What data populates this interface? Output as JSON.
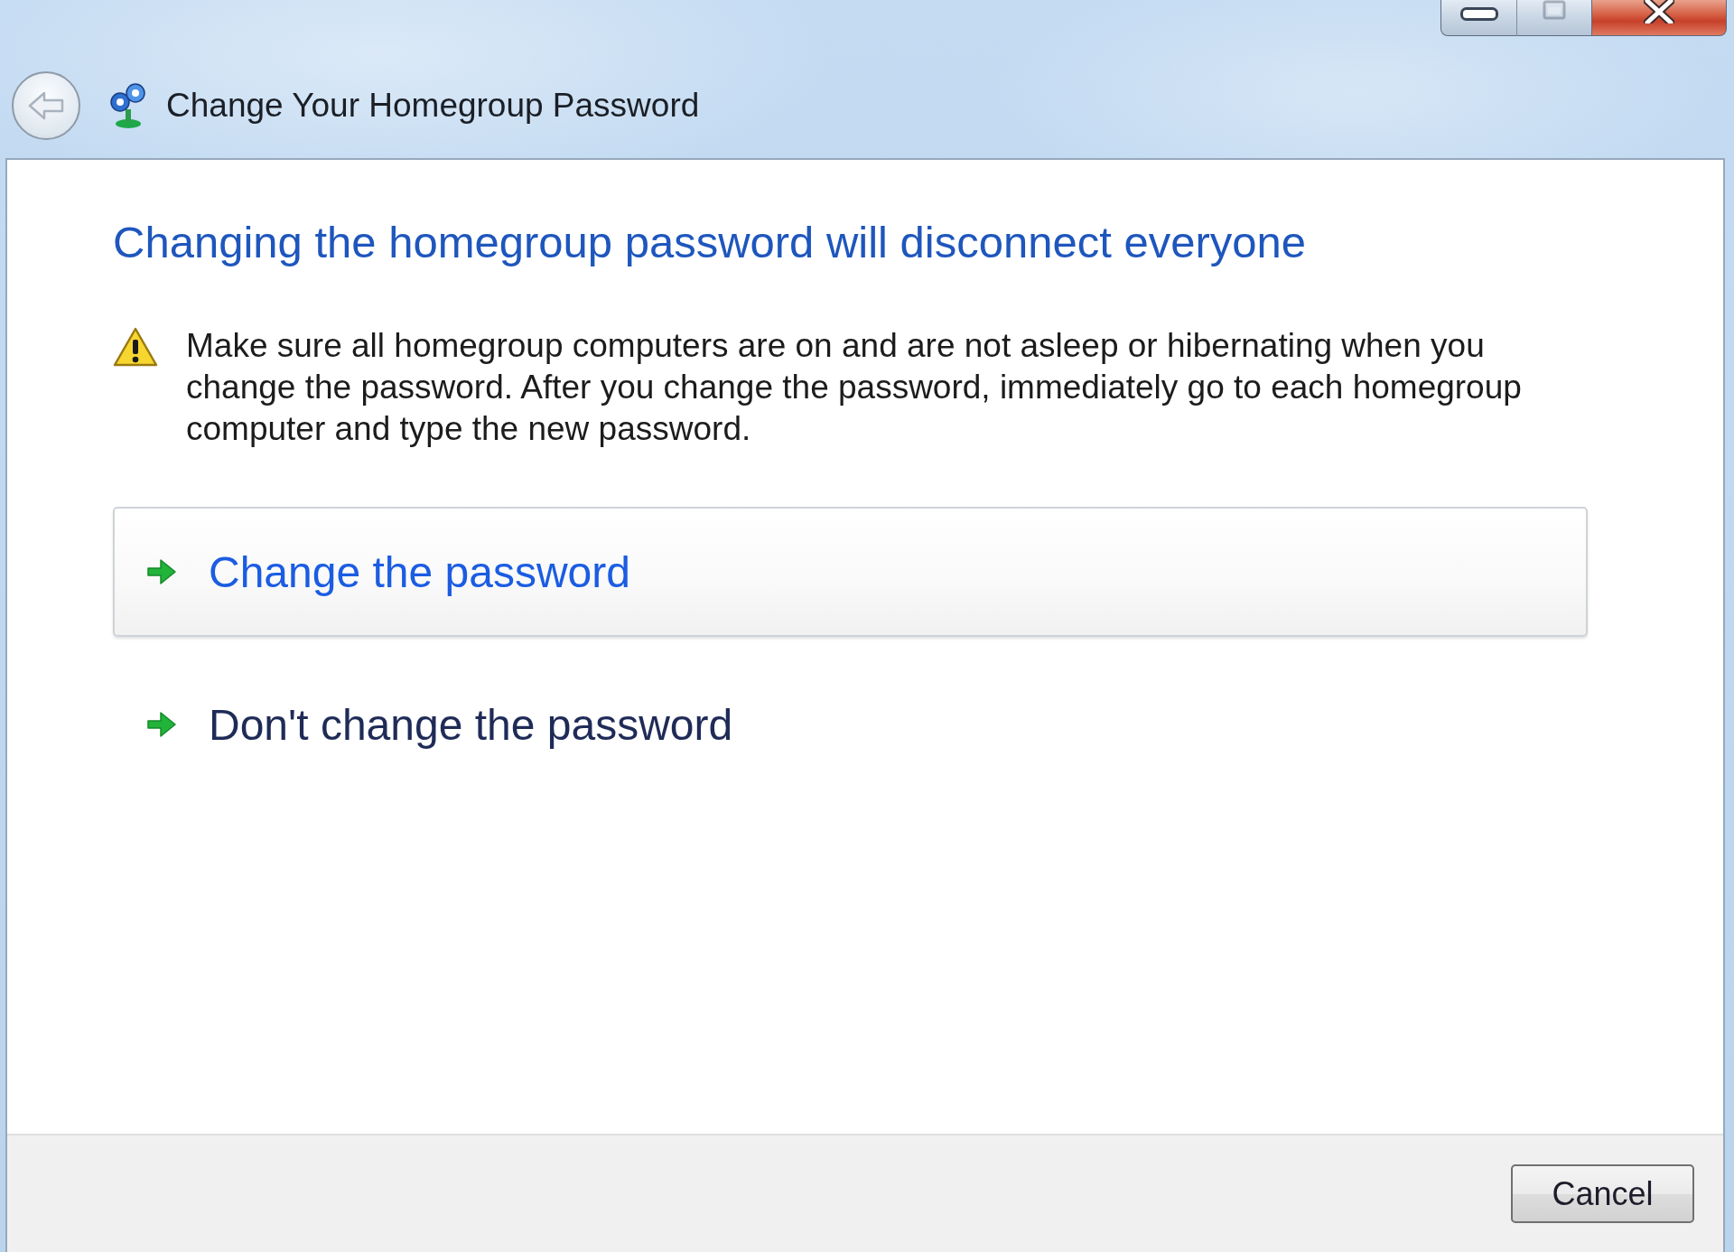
{
  "window": {
    "title": "Change Your Homegroup Password",
    "back_button": {
      "disabled": true
    },
    "caption_buttons": [
      {
        "kind": "minimize",
        "disabled": false
      },
      {
        "kind": "maximize",
        "disabled": true
      },
      {
        "kind": "close",
        "disabled": false
      }
    ]
  },
  "heading": "Changing the homegroup password will disconnect everyone",
  "warning": {
    "text": "Make sure all homegroup computers are on and are not asleep or hibernating when you change the password. After you change the password, immediately go to each homegroup computer and type the new password."
  },
  "options": [
    {
      "label": "Change the password",
      "highlighted": true
    },
    {
      "label": "Don't change the password",
      "highlighted": false
    }
  ],
  "buttons": [
    {
      "label": "Cancel"
    }
  ]
}
